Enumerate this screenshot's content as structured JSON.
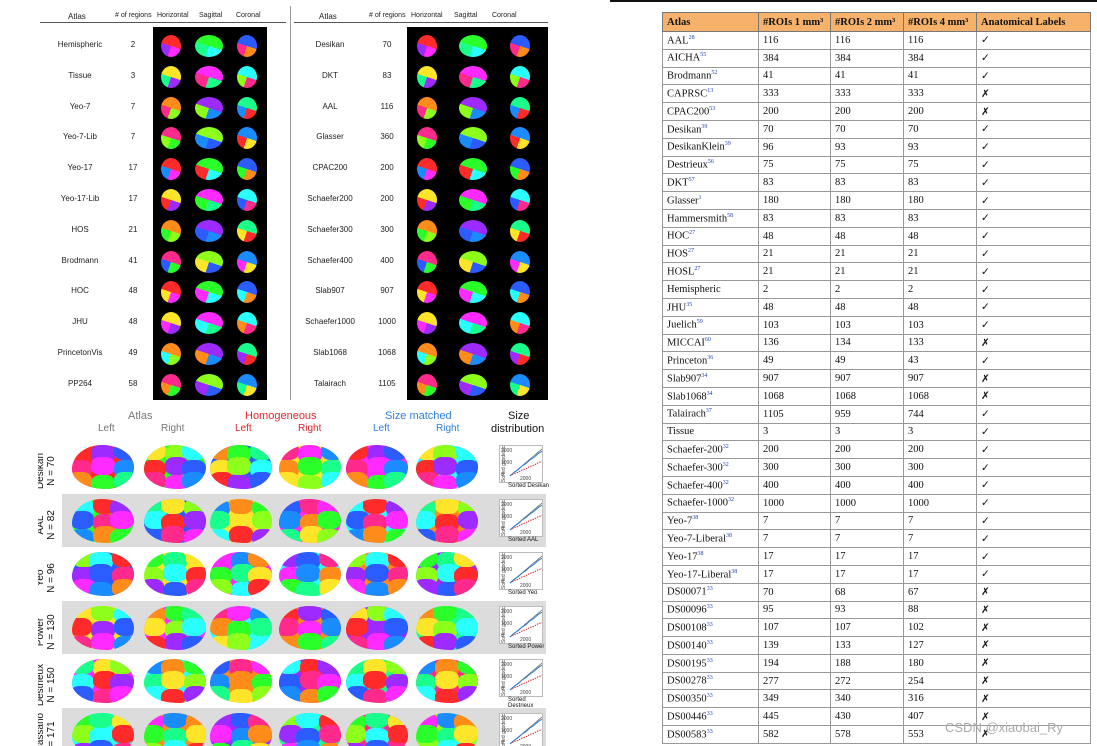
{
  "figure1": {
    "headers": [
      "Atlas",
      "# of regions",
      "Horizontal",
      "Sagittal",
      "Coronal"
    ],
    "left": [
      {
        "name": "Hemispheric",
        "count": "2"
      },
      {
        "name": "Tissue",
        "count": "3"
      },
      {
        "name": "Yeo-7",
        "count": "7"
      },
      {
        "name": "Yeo-7-Lib",
        "count": "7"
      },
      {
        "name": "Yeo-17",
        "count": "17"
      },
      {
        "name": "Yeo-17-Lib",
        "count": "17"
      },
      {
        "name": "HOS",
        "count": "21"
      },
      {
        "name": "Brodmann",
        "count": "41"
      },
      {
        "name": "HOC",
        "count": "48"
      },
      {
        "name": "JHU",
        "count": "48"
      },
      {
        "name": "PrincetonVis",
        "count": "49"
      },
      {
        "name": "PP264",
        "count": "58"
      }
    ],
    "right": [
      {
        "name": "Desikan",
        "count": "70"
      },
      {
        "name": "DKT",
        "count": "83"
      },
      {
        "name": "AAL",
        "count": "116"
      },
      {
        "name": "Glasser",
        "count": "360"
      },
      {
        "name": "CPAC200",
        "count": "200"
      },
      {
        "name": "Schaefer200",
        "count": "200"
      },
      {
        "name": "Schaefer300",
        "count": "300"
      },
      {
        "name": "Schaefer400",
        "count": "400"
      },
      {
        "name": "Slab907",
        "count": "907"
      },
      {
        "name": "Schaefer1000",
        "count": "1000"
      },
      {
        "name": "Slab1068",
        "count": "1068"
      },
      {
        "name": "Talairach",
        "count": "1105"
      }
    ]
  },
  "figure2": {
    "groups": [
      {
        "label": "Atlas",
        "color": "#777777"
      },
      {
        "label": "Homogeneous",
        "color": "#e0262b"
      },
      {
        "label": "Size matched",
        "color": "#2f7fd6"
      },
      {
        "label": "Size",
        "color": "#111111"
      }
    ],
    "size_sub": "distribution",
    "sides": [
      "Left",
      "Right"
    ],
    "rows": [
      {
        "name": "Desikan",
        "n": "N = 70",
        "shade": false,
        "xlabel": "Sorted Desikan"
      },
      {
        "name": "AAL",
        "n": "N = 82",
        "shade": true,
        "xlabel": "Sorted AAL"
      },
      {
        "name": "Yeo",
        "n": "N = 96",
        "shade": false,
        "xlabel": "Sorted Yeo"
      },
      {
        "name": "Power",
        "n": "N = 130",
        "shade": true,
        "xlabel": "Sorted Power"
      },
      {
        "name": "Destrieux",
        "n": "N = 150",
        "shade": false,
        "xlabel": "Sorted Destrieux"
      },
      {
        "name": "Baldassano",
        "n": "N = 171",
        "shade": true,
        "xlabel": ""
      }
    ],
    "mini_ylabel": "Sorted geodesic",
    "mini_yticks": [
      "2000",
      "1000",
      "0"
    ],
    "mini_xtick": "2000"
  },
  "table": {
    "headers": [
      "Atlas",
      "#ROIs 1 mm³",
      "#ROIs 2 mm³",
      "#ROIs 4 mm³",
      "Anatomical Labels"
    ],
    "rows": [
      {
        "name": "AAL",
        "ref": "28",
        "r1": "116",
        "r2": "116",
        "r4": "116",
        "label": "✓"
      },
      {
        "name": "AICHA",
        "ref": "55",
        "r1": "384",
        "r2": "384",
        "r4": "384",
        "label": "✓"
      },
      {
        "name": "Brodmann",
        "ref": "52",
        "r1": "41",
        "r2": "41",
        "r4": "41",
        "label": "✓"
      },
      {
        "name": "CAPRSC",
        "ref": "13",
        "r1": "333",
        "r2": "333",
        "r4": "333",
        "label": "✗"
      },
      {
        "name": "CPAC200",
        "ref": "53",
        "r1": "200",
        "r2": "200",
        "r4": "200",
        "label": "✗"
      },
      {
        "name": "Desikan",
        "ref": "39",
        "r1": "70",
        "r2": "70",
        "r4": "70",
        "label": "✓"
      },
      {
        "name": "DesikanKlein",
        "ref": "39",
        "r1": "96",
        "r2": "93",
        "r4": "93",
        "label": "✓"
      },
      {
        "name": "Destrieux",
        "ref": "56",
        "r1": "75",
        "r2": "75",
        "r4": "75",
        "label": "✓"
      },
      {
        "name": "DKT",
        "ref": "57",
        "r1": "83",
        "r2": "83",
        "r4": "83",
        "label": "✓"
      },
      {
        "name": "Glasser",
        "ref": "1",
        "r1": "180",
        "r2": "180",
        "r4": "180",
        "label": "✓"
      },
      {
        "name": "Hammersmith",
        "ref": "58",
        "r1": "83",
        "r2": "83",
        "r4": "83",
        "label": "✓"
      },
      {
        "name": "HOC",
        "ref": "27",
        "r1": "48",
        "r2": "48",
        "r4": "48",
        "label": "✓"
      },
      {
        "name": "HOS",
        "ref": "27",
        "r1": "21",
        "r2": "21",
        "r4": "21",
        "label": "✓"
      },
      {
        "name": "HOSL",
        "ref": "27",
        "r1": "21",
        "r2": "21",
        "r4": "21",
        "label": "✓"
      },
      {
        "name": "Hemispheric",
        "ref": "",
        "r1": "2",
        "r2": "2",
        "r4": "2",
        "label": "✓"
      },
      {
        "name": "JHU",
        "ref": "35",
        "r1": "48",
        "r2": "48",
        "r4": "48",
        "label": "✓"
      },
      {
        "name": "Juelich",
        "ref": "59",
        "r1": "103",
        "r2": "103",
        "r4": "103",
        "label": "✓"
      },
      {
        "name": "MICCAI",
        "ref": "60",
        "r1": "136",
        "r2": "134",
        "r4": "133",
        "label": "✗"
      },
      {
        "name": "Princeton",
        "ref": "36",
        "r1": "49",
        "r2": "49",
        "r4": "43",
        "label": "✓"
      },
      {
        "name": "Slab907",
        "ref": "34",
        "r1": "907",
        "r2": "907",
        "r4": "907",
        "label": "✗"
      },
      {
        "name": "Slab1068",
        "ref": "34",
        "r1": "1068",
        "r2": "1068",
        "r4": "1068",
        "label": "✗"
      },
      {
        "name": "Talairach",
        "ref": "37",
        "r1": "1105",
        "r2": "959",
        "r4": "744",
        "label": "✓"
      },
      {
        "name": "Tissue",
        "ref": "",
        "r1": "3",
        "r2": "3",
        "r4": "3",
        "label": "✓"
      },
      {
        "name": "Schaefer-200",
        "ref": "32",
        "r1": "200",
        "r2": "200",
        "r4": "200",
        "label": "✓"
      },
      {
        "name": "Schaefer-300",
        "ref": "32",
        "r1": "300",
        "r2": "300",
        "r4": "300",
        "label": "✓"
      },
      {
        "name": "Schaefer-400",
        "ref": "32",
        "r1": "400",
        "r2": "400",
        "r4": "400",
        "label": "✓"
      },
      {
        "name": "Schaefer-1000",
        "ref": "32",
        "r1": "1000",
        "r2": "1000",
        "r4": "1000",
        "label": "✓"
      },
      {
        "name": "Yeo-7",
        "ref": "38",
        "r1": "7",
        "r2": "7",
        "r4": "7",
        "label": "✓"
      },
      {
        "name": "Yeo-7-Liberal",
        "ref": "38",
        "r1": "7",
        "r2": "7",
        "r4": "7",
        "label": "✓"
      },
      {
        "name": "Yeo-17",
        "ref": "38",
        "r1": "17",
        "r2": "17",
        "r4": "17",
        "label": "✓"
      },
      {
        "name": "Yeo-17-Liberal",
        "ref": "38",
        "r1": "17",
        "r2": "17",
        "r4": "17",
        "label": "✓"
      },
      {
        "name": "DS00071",
        "ref": "33",
        "r1": "70",
        "r2": "68",
        "r4": "67",
        "label": "✗"
      },
      {
        "name": "DS00096",
        "ref": "33",
        "r1": "95",
        "r2": "93",
        "r4": "88",
        "label": "✗"
      },
      {
        "name": "DS00108",
        "ref": "33",
        "r1": "107",
        "r2": "107",
        "r4": "102",
        "label": "✗"
      },
      {
        "name": "DS00140",
        "ref": "33",
        "r1": "139",
        "r2": "133",
        "r4": "127",
        "label": "✗"
      },
      {
        "name": "DS00195",
        "ref": "33",
        "r1": "194",
        "r2": "188",
        "r4": "180",
        "label": "✗"
      },
      {
        "name": "DS00278",
        "ref": "33",
        "r1": "277",
        "r2": "272",
        "r4": "254",
        "label": "✗"
      },
      {
        "name": "DS00350",
        "ref": "33",
        "r1": "349",
        "r2": "340",
        "r4": "316",
        "label": "✗"
      },
      {
        "name": "DS00446",
        "ref": "33",
        "r1": "445",
        "r2": "430",
        "r4": "407",
        "label": "✗"
      },
      {
        "name": "DS00583",
        "ref": "33",
        "r1": "582",
        "r2": "578",
        "r4": "553",
        "label": "✗"
      }
    ]
  },
  "watermark": "CSDN @xiaobai_Ry",
  "palette": [
    "#ff2a2a",
    "#2aff2a",
    "#2a5cff",
    "#ffe52a",
    "#ff2aff",
    "#2affff",
    "#ff8c1a",
    "#9d2aff",
    "#1aff8c",
    "#ff2a8c",
    "#8cff1a",
    "#1a8cff"
  ]
}
